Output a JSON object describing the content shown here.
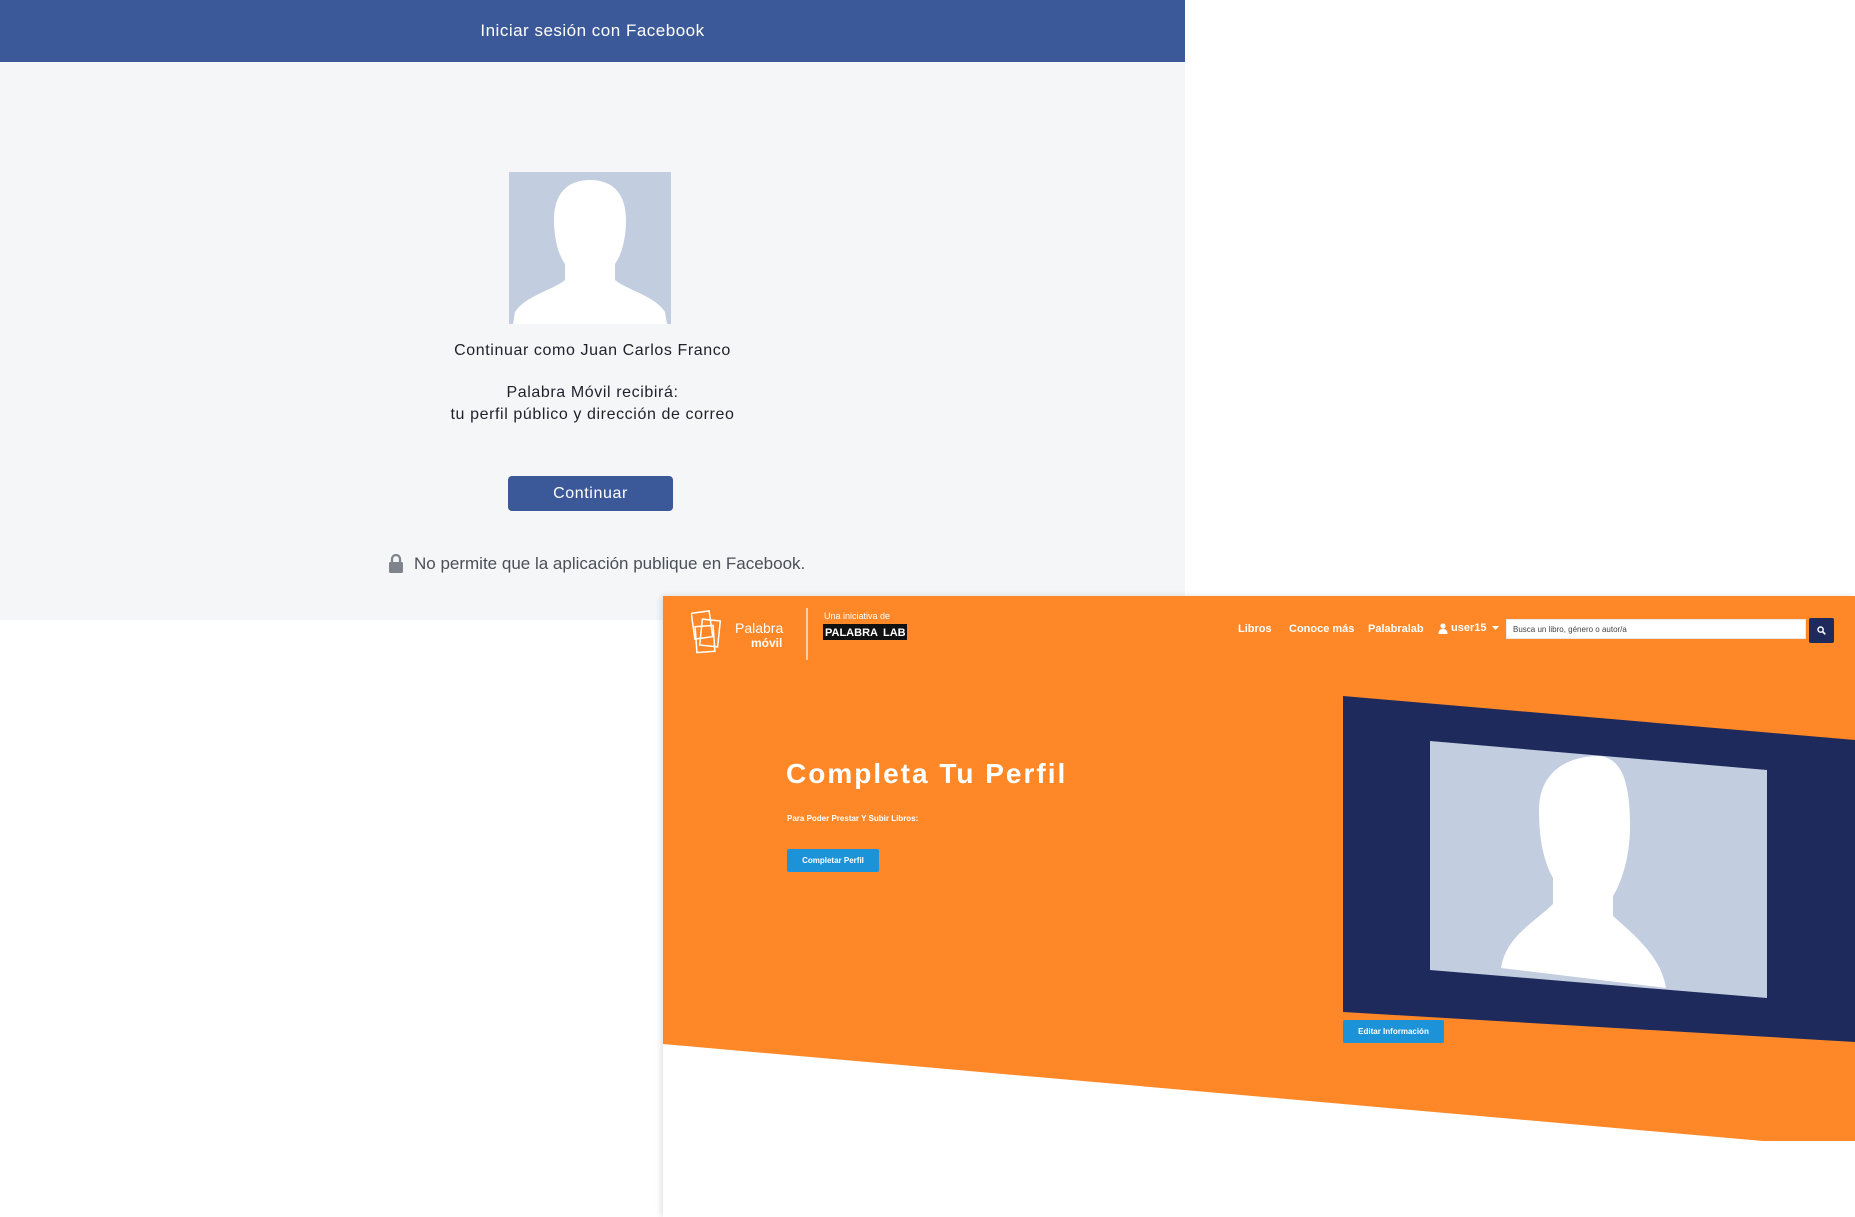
{
  "facebook_dialog": {
    "header_title": "Iniciar sesión con Facebook",
    "continue_as": "Continuar como Juan Carlos Franco",
    "will_receive": "Palabra Móvil recibirá:",
    "scope": "tu perfil público y dirección de correo",
    "continue_button": "Continuar",
    "privacy_note": "No permite que la aplicación publique en Facebook.",
    "icons": {
      "lock": "lock-icon",
      "avatar": "default-avatar-silhouette"
    },
    "colors": {
      "header": "#3b5998",
      "button": "#3b5998",
      "background": "#f5f6f8"
    }
  },
  "palabra_movil": {
    "logo": {
      "brand_top": "Palabra",
      "brand_bottom": "móvil",
      "initiative": "Una iniciativa de",
      "partner_a": "PALABRA",
      "partner_b": "LAB"
    },
    "nav": {
      "libros": "Libros",
      "conoce": "Conoce más",
      "palabralab": "Palabralab",
      "user": "user15"
    },
    "search": {
      "placeholder": "Busca un libro, género o autor/a"
    },
    "hero": {
      "title": "Completa Tu Perfil",
      "subtitle": "Para Poder Prestar Y Subir Libros:",
      "complete_button": "Completar Perfil",
      "edit_button": "Editar Información"
    },
    "icons": {
      "search": "search-icon",
      "user": "user-icon",
      "caret": "caret-down-icon"
    },
    "colors": {
      "orange": "#fe8727",
      "navy": "#1f2a5c",
      "button_blue": "#1c92d8"
    }
  }
}
